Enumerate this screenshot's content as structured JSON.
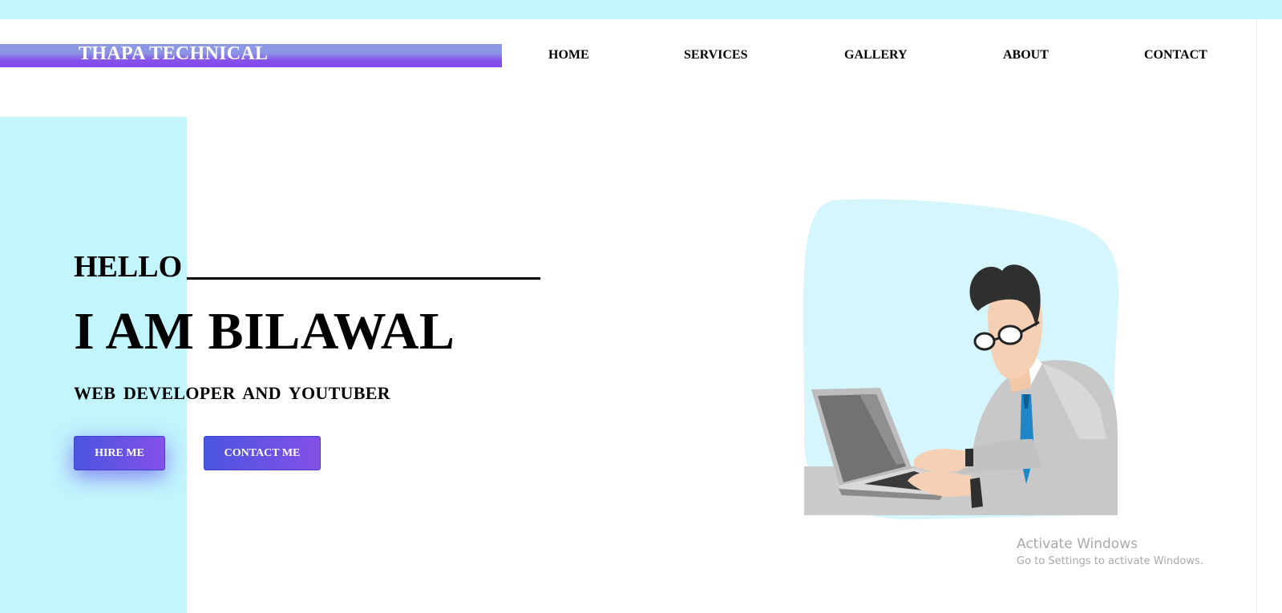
{
  "brand": {
    "name": "THAPA TECHNICAL"
  },
  "nav": {
    "items": [
      {
        "label": "HOME"
      },
      {
        "label": "SERVICES"
      },
      {
        "label": "GALLERY"
      },
      {
        "label": "ABOUT"
      },
      {
        "label": "CONTACT"
      }
    ]
  },
  "hero": {
    "greeting": "HELLO",
    "headline": "I AM BILAWAL",
    "subtitle": "WEB DEVELOPER AND YOUTUBER",
    "primary_button": "HIRE ME",
    "secondary_button": "CONTACT ME",
    "illustration": "man-with-laptop-illustration"
  },
  "watermark": {
    "title": "Activate Windows",
    "subtitle": "Go to Settings to activate Windows."
  },
  "colors": {
    "accent_light": "#c2f5fd",
    "button_gradient_start": "#4a55df",
    "button_gradient_end": "#8450e8",
    "brand_bar_top": "#8d9ae6",
    "brand_bar_bottom": "#8349ea"
  }
}
